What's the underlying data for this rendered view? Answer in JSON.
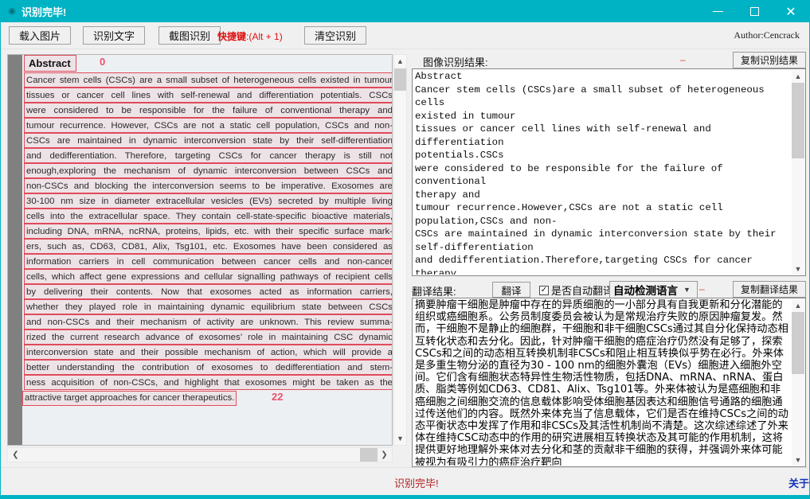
{
  "window": {
    "title": "识别完毕!",
    "icon": "app-eye-icon",
    "minimize": "—",
    "maximize": "□",
    "close": "✕",
    "accent_color": "#00b3c4"
  },
  "toolbar": {
    "load_image": "载入图片",
    "recognize_text": "识别文字",
    "screenshot_recognize": "截图识别",
    "hotkey_label": "快捷键",
    "hotkey_value": ":(Alt + 1)",
    "hotkey_color": "#e01010",
    "clear": "清空识别",
    "author": "Author:Cencrack"
  },
  "image_pane": {
    "abstract_heading": "Abstract",
    "abstract_index": "0",
    "end_index": "22",
    "lines": [
      "Cancer stem cells (CSCs) are a small subset of heterogeneous cells existed in tumour",
      "tissues or cancer cell lines with self-renewal and differentiation potentials. CSCs",
      "were considered to be responsible for the failure of conventional therapy and",
      "tumour recurrence. However, CSCs are not a static cell population, CSCs and non-",
      "CSCs are maintained in dynamic interconversion state by their self-differentiation",
      "and dedifferentiation. Therefore, targeting CSCs for cancer therapy is still not",
      "enough,exploring the mechanism of dynamic interconversion between CSCs and",
      "non-CSCs and blocking the interconversion seems to be imperative. Exosomes are",
      "30-100 nm size in diameter extracellular vesicles (EVs) secreted by multiple living",
      "cells into the extracellular space. They contain cell-state-specific bioactive materials,",
      "including DNA, mRNA, ncRNA, proteins, lipids, etc. with their specific surface mark-",
      "ers, such as, CD63, CD81, Alix, Tsg101, etc. Exosomes have been considered as",
      "information carriers in cell communication between cancer cells and non-cancer",
      "cells, which affect gene expressions and cellular signalling pathways of recipient cells",
      "by delivering their contents. Now that exosomes acted as information carriers,",
      "whether they played role in maintaining dynamic equilibrium state between CSCs",
      "and non-CSCs and their mechanism of activity are unknown. This review summa-",
      "rized the current research advance of exosomes’ role in maintaining CSC dynamic",
      "interconversion state and their possible mechanism of action, which will provide a",
      "better understanding the contribution of exosomes to dedifferentiation and stem-",
      "ness acquisition of non-CSCs, and highlight that exosomes might be taken as the"
    ],
    "last_line": "attractive target approaches for cancer therapeutics.",
    "box_color": "#e04a5a",
    "scroll_up_icon": "chevron-up-icon",
    "scroll_down_icon": "chevron-down-icon",
    "scroll_left_icon": "chevron-left-icon",
    "scroll_right_icon": "chevron-right-icon"
  },
  "ocr_panel": {
    "label": "图像识别结果:",
    "marker": "–",
    "copy_button": "复制识别结果",
    "text": "Abstract\nCancer stem cells (CSCs)are a small subset of heterogeneous cells\nexisted in tumour\ntissues or cancer cell lines with self-renewal and differentiation\npotentials.CSCs\nwere considered to be responsible for the failure of conventional\ntherapy and\ntumour recurrence.However,CSCs are not a static cell\npopulation,CSCs and non-\nCSCs are maintained in dynamic interconversion state by their\nself-differentiation\nand dedifferentiation.Therefore,targeting CSCs for cancer therapy\nis still not\nenough, exploring the mechanism of dynamic interconversion between\nCSCs and\nnon-CSCs and blocking the interconversion seems to be\nimperative.Exosomes are\n30-100 nm size in diameter extracellular vesicles (EVs) secreted by"
  },
  "translate_panel": {
    "label": "翻译结果:",
    "translate_button": "翻译",
    "auto_translate_checkbox": "是否自动翻译",
    "auto_translate_checked": "☑",
    "language_select": "自动检测语言",
    "language_caret": "chevron-down-icon",
    "marker": "–",
    "copy_button": "复制翻译结果",
    "text": "摘要肿瘤干细胞是肿瘤中存在的异质细胞的一小部分具有自我更新和分化潜能的组织或癌细胞系。公务员制度委员会被认为是常规治疗失败的原因肿瘤复发。然而，干细胞不是静止的细胞群，干细胞和非干细胞CSCs通过其自分化保持动态相互转化状态和去分化。因此，针对肿瘤干细胞的癌症治疗仍然没有足够了，探索CSCs和之间的动态相互转换机制非CSCs和阻止相互转换似乎势在必行。外来体是多重生物分泌的直径为30 - 100 nm的细胞外囊泡（EVs）细胞进入细胞外空间。它们含有细胞状态特异性生物活性物质，包括DNA、mRNA、nRNA、蛋白质、脂类等例如CD63、CD81、Alix、Tsg101等。外来体被认为是癌细胞和非癌细胞之间细胞交流的信息载体影响受体细胞基因表达和细胞信号通路的细胞通过传送他们的内容。既然外来体充当了信息载体，它们是否在维持CSCs之间的动态平衡状态中发挥了作用和非CSCs及其活性机制尚不清楚。这次综述综述了外来体在维持CSC动态中的作用的研究进展相互转换状态及其可能的作用机制，这将提供更好地理解外来体对去分化和茎的贡献非干细胞的获得，并强调外来体可能被视为有吸引力的癌症治疗靶向"
  },
  "status_bar": {
    "message": "识别完毕!",
    "message_color": "#b02020",
    "about_link": "关于"
  }
}
